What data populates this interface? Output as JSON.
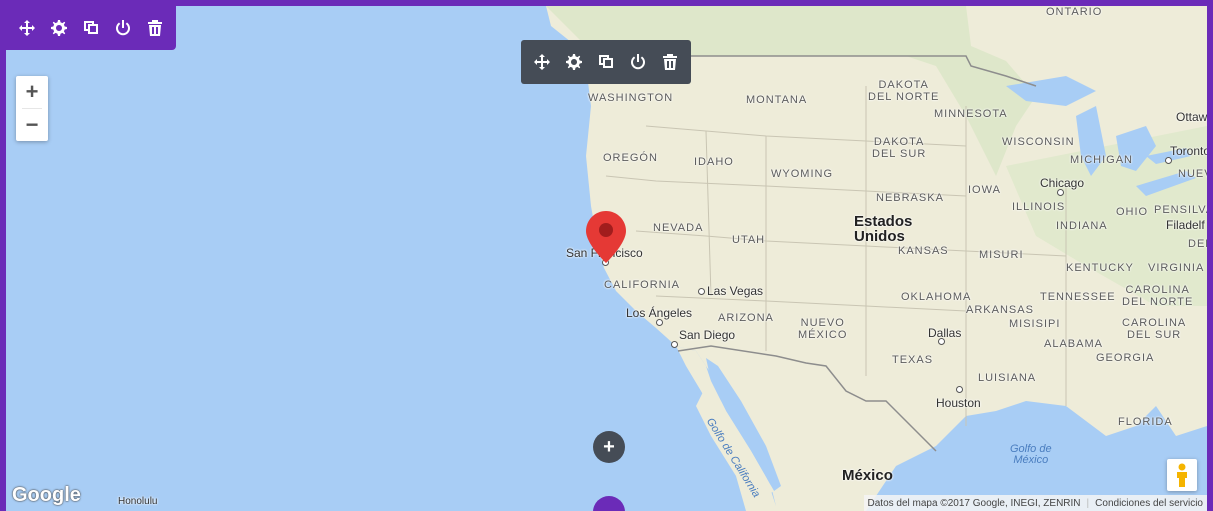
{
  "colors": {
    "frame": "#6b2bb8",
    "ocean": "#a8cdf5",
    "land": "#f1efe0",
    "toolbar_dark": "#454c56",
    "pin": "#e53935"
  },
  "toolbar_icons": [
    "move-icon",
    "settings-icon",
    "duplicate-icon",
    "power-icon",
    "delete-icon"
  ],
  "zoom": {
    "in": "+",
    "out": "−"
  },
  "labels": {
    "ontario": "ONTARIO",
    "washington": "WASHINGTON",
    "montana": "MONTANA",
    "north_dakota": "DAKOTA\nDEL NORTE",
    "minnesota": "MINNESOTA",
    "ottawa": "Ottawa",
    "wisconsin": "WISCONSIN",
    "south_dakota": "DAKOTA\nDEL SUR",
    "michigan": "MICHIGAN",
    "toronto": "Toronto",
    "oregon": "OREGÓN",
    "idaho": "IDAHO",
    "wyoming": "WYOMING",
    "chicago": "Chicago",
    "nueva": "NUEVA",
    "iowa": "IOWA",
    "nebraska": "NEBRASKA",
    "illinois": "ILLINOIS",
    "ohio": "OHIO",
    "pensilvania": "PENSILVA",
    "nevada": "NEVADA",
    "usa": "Estados\nUnidos",
    "indiana": "INDIANA",
    "filadelfia": "Filadelf",
    "utah": "UTAH",
    "san_francisco": "San Francisco",
    "kansas": "KANSAS",
    "misuri": "MISURI",
    "del": "DEL",
    "kentucky": "KENTUCKY",
    "virginia": "VIRGINIA",
    "california": "CALIFORNIA",
    "las_vegas": "Las Vegas",
    "oklahoma": "OKLAHOMA",
    "tennessee": "TENNESSEE",
    "carolina_norte": "CAROLINA\nDEL NORTE",
    "los_angeles": "Los Ángeles",
    "arizona": "ARIZONA",
    "nuevo_mexico": "NUEVO\nMÉXICO",
    "arkansas": "ARKANSAS",
    "san_diego": "San Diego",
    "dallas": "Dallas",
    "misisipi": "MISISIPI",
    "carolina_sur": "CAROLINA\nDEL SUR",
    "alabama": "ALABAMA",
    "georgia": "GEORGIA",
    "texas": "TEXAS",
    "luisiana": "LUISIANA",
    "houston": "Houston",
    "florida": "FLORIDA",
    "golfo_california": "Golfo de California",
    "golfo_mexico": "Golfo de\nMéxico",
    "mexico": "México",
    "honolulu": "Honolulu"
  },
  "google_logo": "Google",
  "attribution": {
    "data": "Datos del mapa ©2017 Google, INEGI, ZENRIN",
    "terms": "Condiciones del servicio"
  },
  "add_button": "+"
}
